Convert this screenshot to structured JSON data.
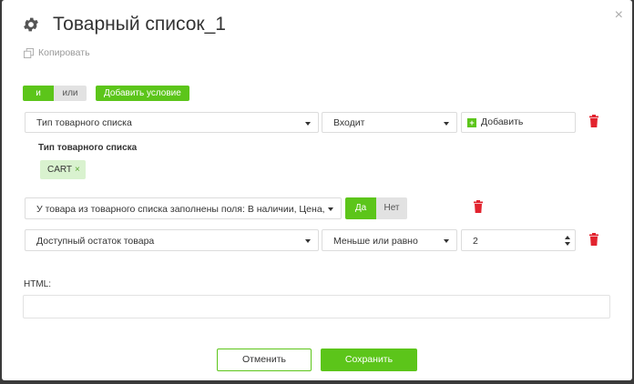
{
  "modal": {
    "title": "Товарный список_1",
    "copy_label": "Копировать",
    "close_icon": "×"
  },
  "logic": {
    "and_label": "и",
    "or_label": "или",
    "active": "и",
    "add_condition_label": "Добавить условие"
  },
  "conditions": [
    {
      "field": "Тип товарного списка",
      "operator": "Входит",
      "add_label": "Добавить",
      "values_title": "Тип товарного списка",
      "tags": [
        "CART"
      ]
    },
    {
      "field": "У товара из товарного списка заполнены поля: В наличии, Цена,",
      "yes_label": "Да",
      "no_label": "Нет",
      "selected": "Да"
    },
    {
      "field": "Доступный остаток товара",
      "operator": "Меньше или равно",
      "value": "2"
    }
  ],
  "html_field": {
    "label": "HTML:",
    "value": ""
  },
  "footer": {
    "cancel_label": "Отменить",
    "save_label": "Сохранить"
  },
  "colors": {
    "accent": "#5cc51a",
    "danger": "#e2232e",
    "tag_bg": "#d9f2cf"
  }
}
